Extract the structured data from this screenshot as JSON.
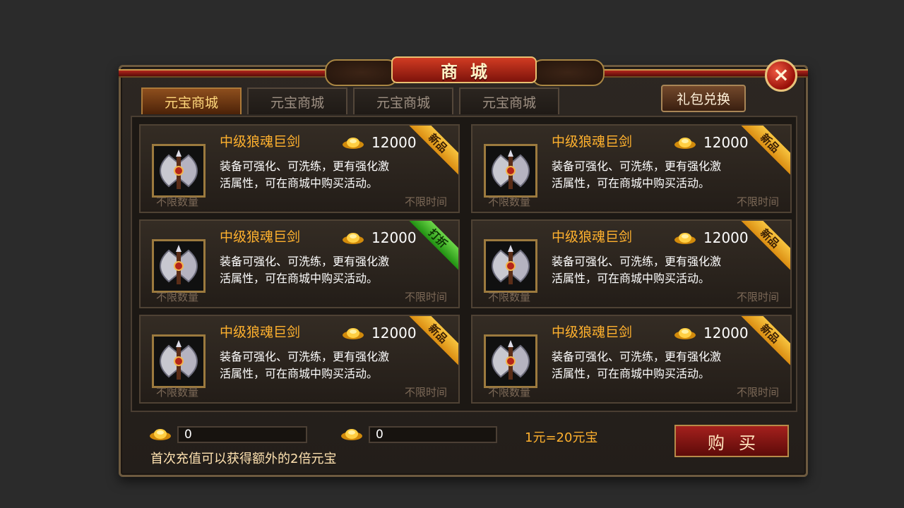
{
  "window": {
    "title": "商城",
    "close_label": "×"
  },
  "tabs": [
    {
      "label": "元宝商城",
      "active": true
    },
    {
      "label": "元宝商城",
      "active": false
    },
    {
      "label": "元宝商城",
      "active": false
    },
    {
      "label": "元宝商城",
      "active": false
    }
  ],
  "gift_exchange_label": "礼包兑换",
  "items": [
    {
      "name": "中级狼魂巨剑",
      "price": "12000",
      "desc_line1": "装备可强化、可洗练，更有强化激",
      "desc_line2": "活属性，可在商城中购买活动。",
      "quantity": "不限数量",
      "time": "不限时间",
      "ribbon": "新品",
      "ribbon_type": "new"
    },
    {
      "name": "中级狼魂巨剑",
      "price": "12000",
      "desc_line1": "装备可强化、可洗练，更有强化激",
      "desc_line2": "活属性，可在商城中购买活动。",
      "quantity": "不限数量",
      "time": "不限时间",
      "ribbon": "新品",
      "ribbon_type": "new"
    },
    {
      "name": "中级狼魂巨剑",
      "price": "12000",
      "desc_line1": "装备可强化、可洗练，更有强化激",
      "desc_line2": "活属性，可在商城中购买活动。",
      "quantity": "不限数量",
      "time": "不限时间",
      "ribbon": "打折",
      "ribbon_type": "sale"
    },
    {
      "name": "中级狼魂巨剑",
      "price": "12000",
      "desc_line1": "装备可强化、可洗练，更有强化激",
      "desc_line2": "活属性，可在商城中购买活动。",
      "quantity": "不限数量",
      "time": "不限时间",
      "ribbon": "新品",
      "ribbon_type": "new"
    },
    {
      "name": "中级狼魂巨剑",
      "price": "12000",
      "desc_line1": "装备可强化、可洗练，更有强化激",
      "desc_line2": "活属性，可在商城中购买活动。",
      "quantity": "不限数量",
      "time": "不限时间",
      "ribbon": "新品",
      "ribbon_type": "new"
    },
    {
      "name": "中级狼魂巨剑",
      "price": "12000",
      "desc_line1": "装备可强化、可洗练，更有强化激",
      "desc_line2": "活属性，可在商城中购买活动。",
      "quantity": "不限数量",
      "time": "不限时间",
      "ribbon": "新品",
      "ribbon_type": "new"
    }
  ],
  "bottom": {
    "amount1": "0",
    "amount2": "0",
    "rate": "1元=20元宝",
    "hint": "首次充值可以获得额外的2倍元宝",
    "buy_label": "购买"
  },
  "colors": {
    "accent": "#ffb12e",
    "ribbon_new": "#f7c43f",
    "ribbon_sale": "#6cd748"
  }
}
